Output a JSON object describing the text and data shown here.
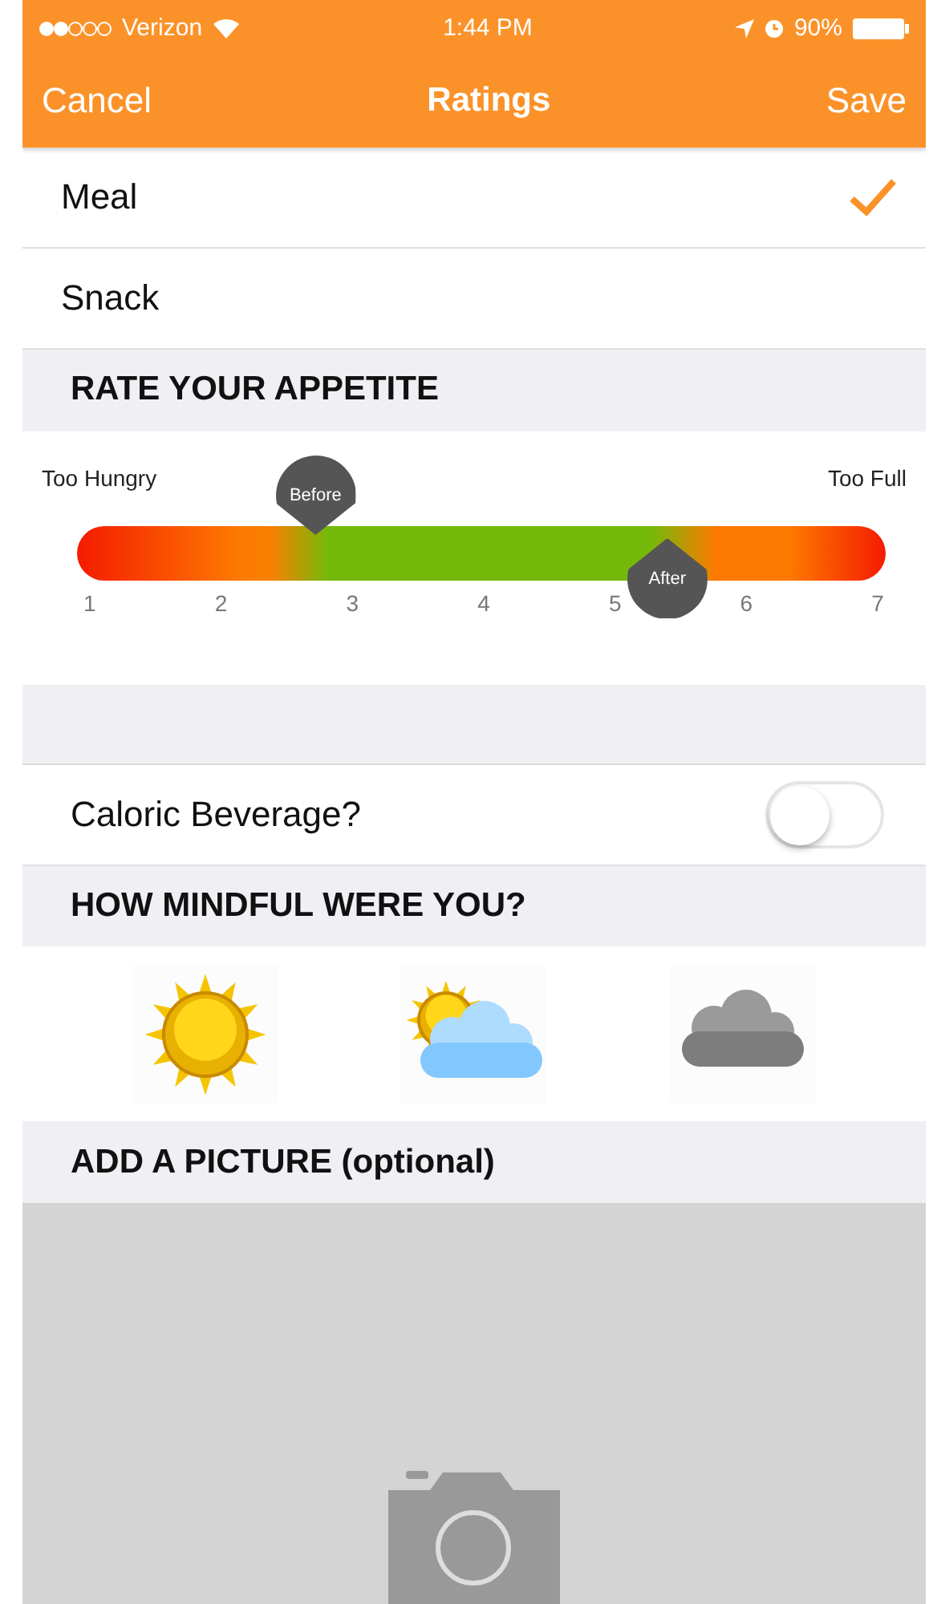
{
  "status_bar": {
    "carrier": "Verizon",
    "time": "1:44 PM",
    "battery": "90%"
  },
  "nav": {
    "left": "Cancel",
    "title": "Ratings",
    "right": "Save"
  },
  "meal_types": [
    {
      "label": "Meal",
      "checked": true
    },
    {
      "label": "Snack",
      "checked": false
    }
  ],
  "appetite": {
    "header": "RATE YOUR APPETITE",
    "left_label": "Too Hungry",
    "right_label": "Too Full",
    "markers": [
      {
        "label": "Before",
        "level": 0.295,
        "kind": "above"
      },
      {
        "label": "After",
        "level": 0.73,
        "kind": "below"
      }
    ],
    "ticks": [
      "1",
      "2",
      "3",
      "4",
      "5",
      "6",
      "7"
    ]
  },
  "caloric_beverage": {
    "label": "Caloric Beverage?",
    "on": false
  },
  "mindful": {
    "header": "HOW MINDFUL WERE YOU?",
    "options": [
      {
        "kind": "sunny"
      },
      {
        "kind": "partly-cloudy"
      },
      {
        "kind": "cloudy"
      }
    ]
  },
  "picture": {
    "header": "ADD A PICTURE (optional)"
  }
}
